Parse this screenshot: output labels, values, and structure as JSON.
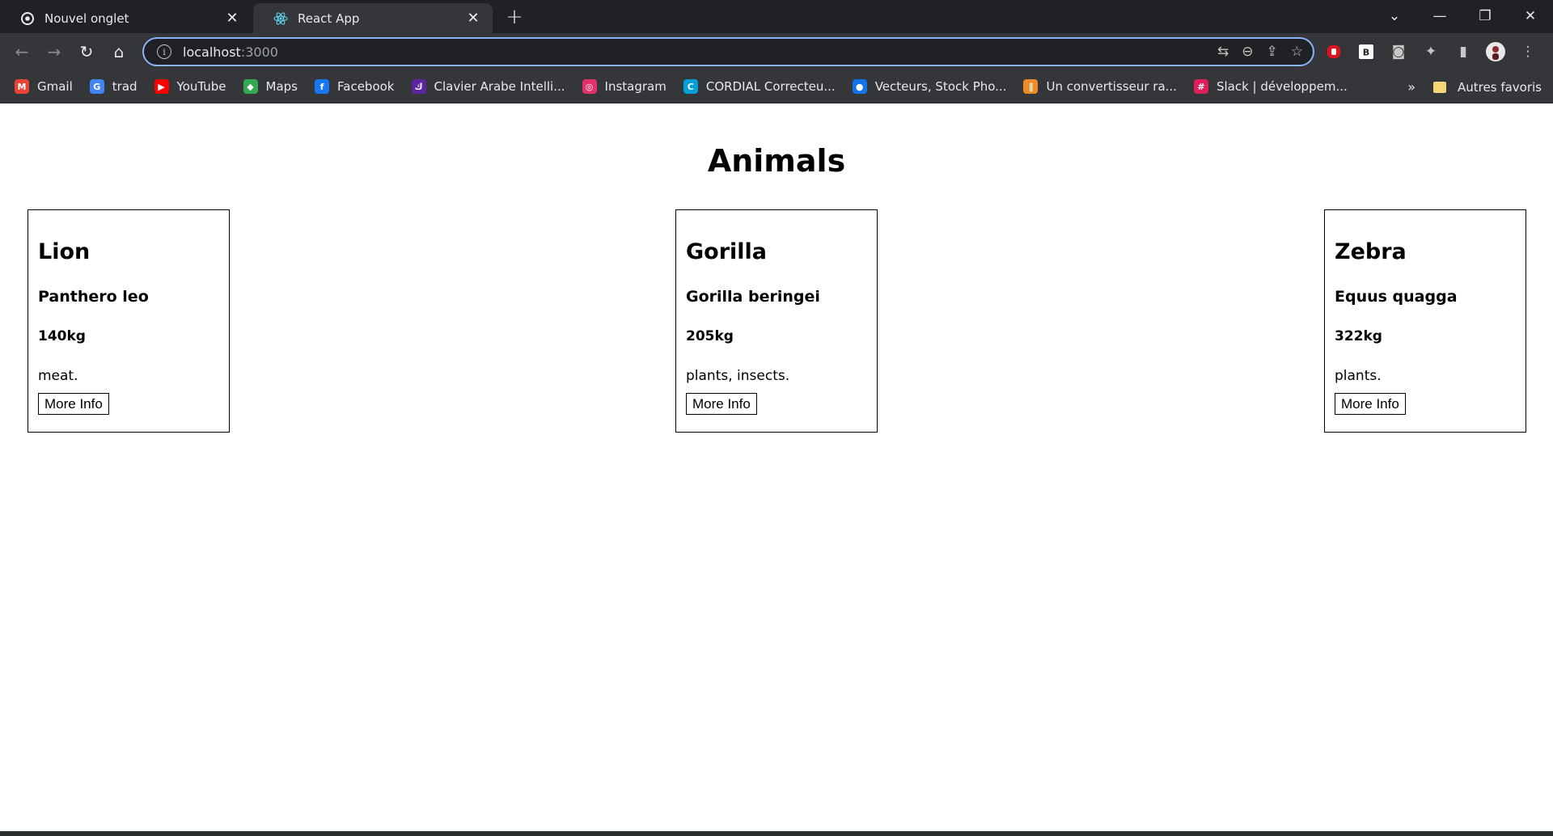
{
  "tabs": [
    {
      "title": "Nouvel onglet",
      "icon": "chrome-icon",
      "active": false
    },
    {
      "title": "React App",
      "icon": "react-icon",
      "active": true
    }
  ],
  "toolbar": {
    "url_host": "localhost",
    "url_port": ":3000"
  },
  "bookmarks": [
    {
      "label": "Gmail",
      "icon": "gmail-icon",
      "color": "#ea4335"
    },
    {
      "label": "trad",
      "icon": "translate-icon",
      "color": "#4285f4"
    },
    {
      "label": "YouTube",
      "icon": "youtube-icon",
      "color": "#ff0000"
    },
    {
      "label": "Maps",
      "icon": "maps-icon",
      "color": "#34a853"
    },
    {
      "label": "Facebook",
      "icon": "facebook-icon",
      "color": "#1877f2"
    },
    {
      "label": "Clavier Arabe Intelli...",
      "icon": "keyboard-icon",
      "color": "#5f259f"
    },
    {
      "label": "Instagram",
      "icon": "instagram-icon",
      "color": "#e1306c"
    },
    {
      "label": "CORDIAL Correcteu...",
      "icon": "cordial-icon",
      "color": "#00a0d6"
    },
    {
      "label": "Vecteurs, Stock Pho...",
      "icon": "freepik-icon",
      "color": "#1273eb"
    },
    {
      "label": "Un convertisseur ra...",
      "icon": "audio-icon",
      "color": "#f08a24"
    },
    {
      "label": "Slack | développem...",
      "icon": "slack-icon",
      "color": "#e01e5a"
    }
  ],
  "bookmarks_folder": "Autres favoris",
  "page": {
    "heading": "Animals",
    "animals": [
      {
        "name": "Lion",
        "scientific": "Panthero leo",
        "weight": "140kg",
        "diet": "meat.",
        "button": "More Info"
      },
      {
        "name": "Gorilla",
        "scientific": "Gorilla beringei",
        "weight": "205kg",
        "diet": "plants, insects.",
        "button": "More Info"
      },
      {
        "name": "Zebra",
        "scientific": "Equus quagga",
        "weight": "322kg",
        "diet": "plants.",
        "button": "More Info"
      }
    ]
  }
}
